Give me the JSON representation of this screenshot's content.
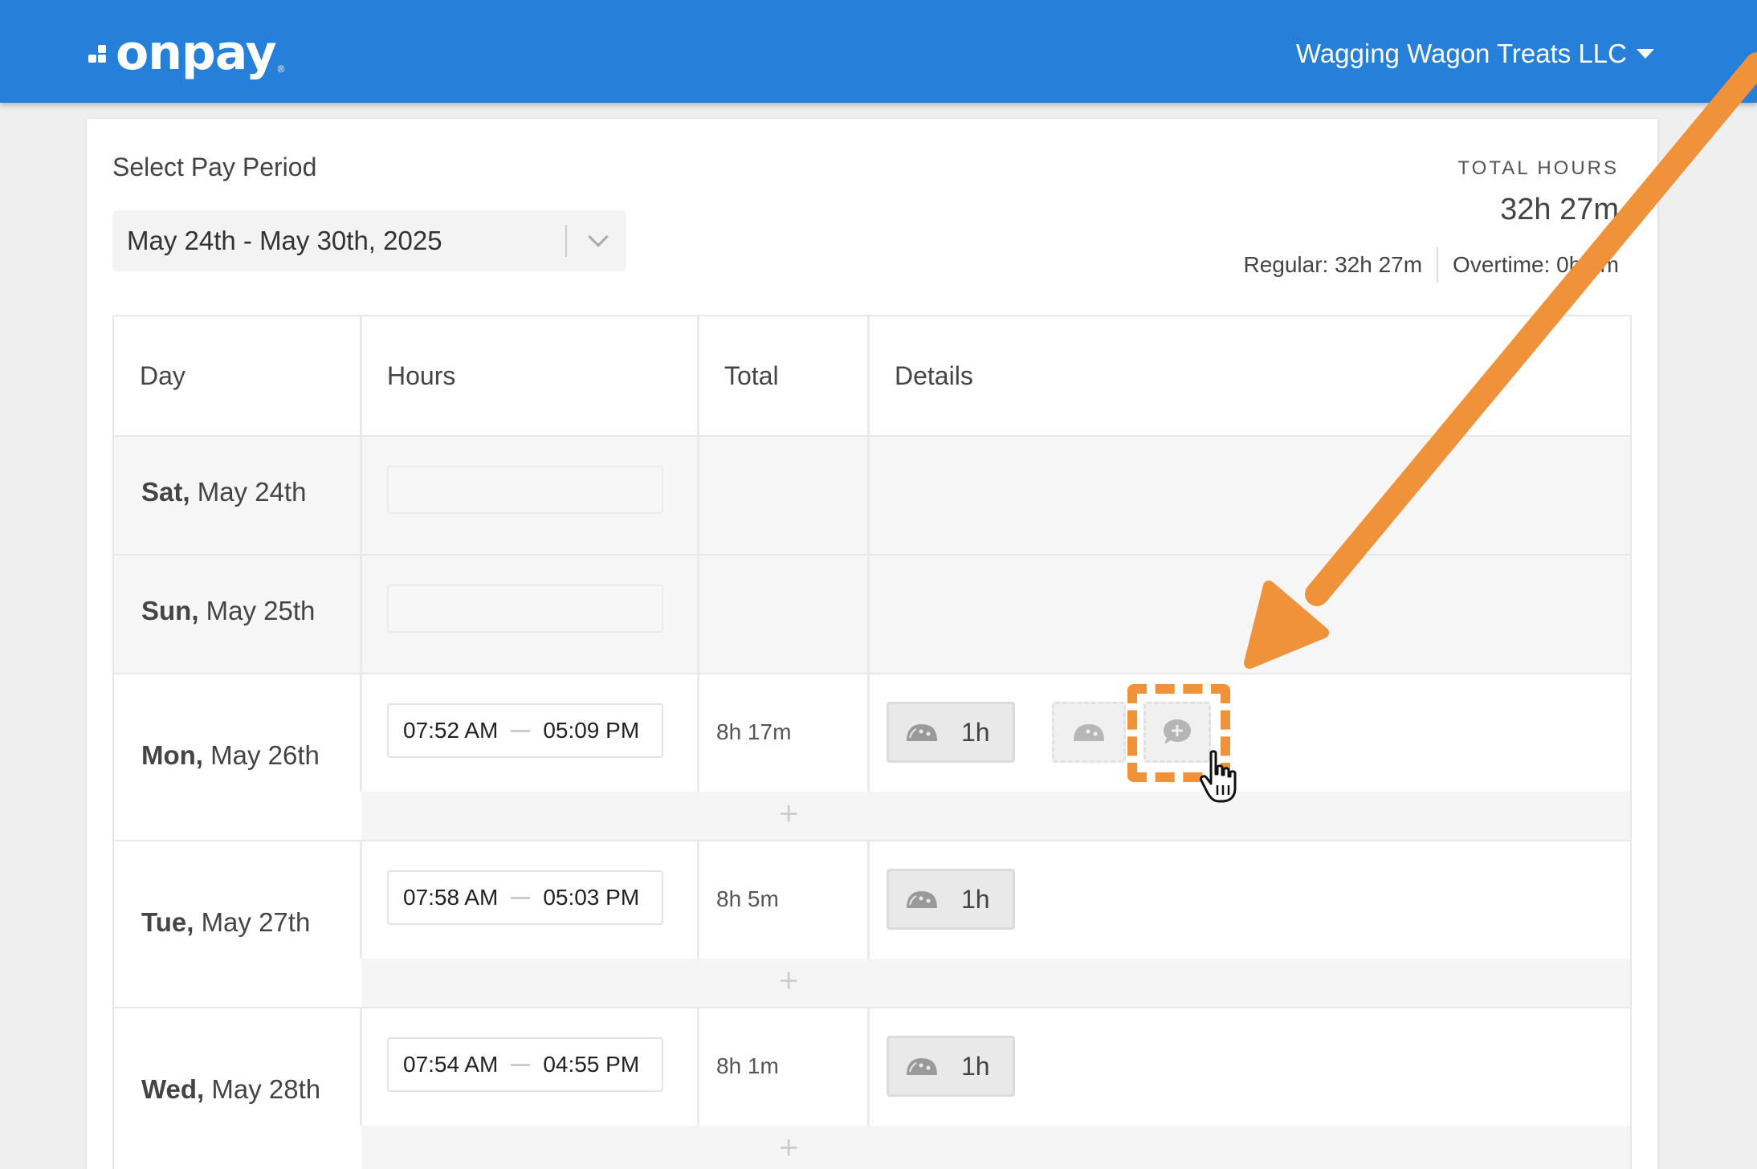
{
  "header": {
    "logo_text": "onpay",
    "logo_mark": "®",
    "company_name": "Wagging Wagon Treats LLC"
  },
  "pay_period": {
    "label": "Select Pay Period",
    "selected": "May 24th - May 30th, 2025"
  },
  "totals": {
    "label": "TOTAL HOURS",
    "value": "32h 27m",
    "regular": "Regular: 32h 27m",
    "overtime": "Overtime: 0h 0m"
  },
  "table": {
    "columns": [
      "Day",
      "Hours",
      "Total",
      "Details"
    ],
    "rows": [
      {
        "weekday": "Sat,",
        "date": "May 24th"
      },
      {
        "weekday": "Sun,",
        "date": "May 25th"
      },
      {
        "weekday": "Mon,",
        "date": "May 26th",
        "start": "07:52 AM",
        "end": "05:09 PM",
        "total": "8h 17m",
        "break": "1h"
      },
      {
        "weekday": "Tue,",
        "date": "May 27th",
        "start": "07:58 AM",
        "end": "05:03 PM",
        "total": "8h 5m",
        "break": "1h"
      },
      {
        "weekday": "Wed,",
        "date": "May 28th",
        "start": "07:54 AM",
        "end": "04:55 PM",
        "total": "8h 1m",
        "break": "1h"
      }
    ],
    "add_symbol": "+"
  },
  "colors": {
    "brand_blue": "#2680d9",
    "annotation_orange": "#f0923a"
  },
  "icons": {
    "break": "taco-icon",
    "add_note": "comment-plus-icon",
    "pointer": "hand-cursor-icon"
  }
}
